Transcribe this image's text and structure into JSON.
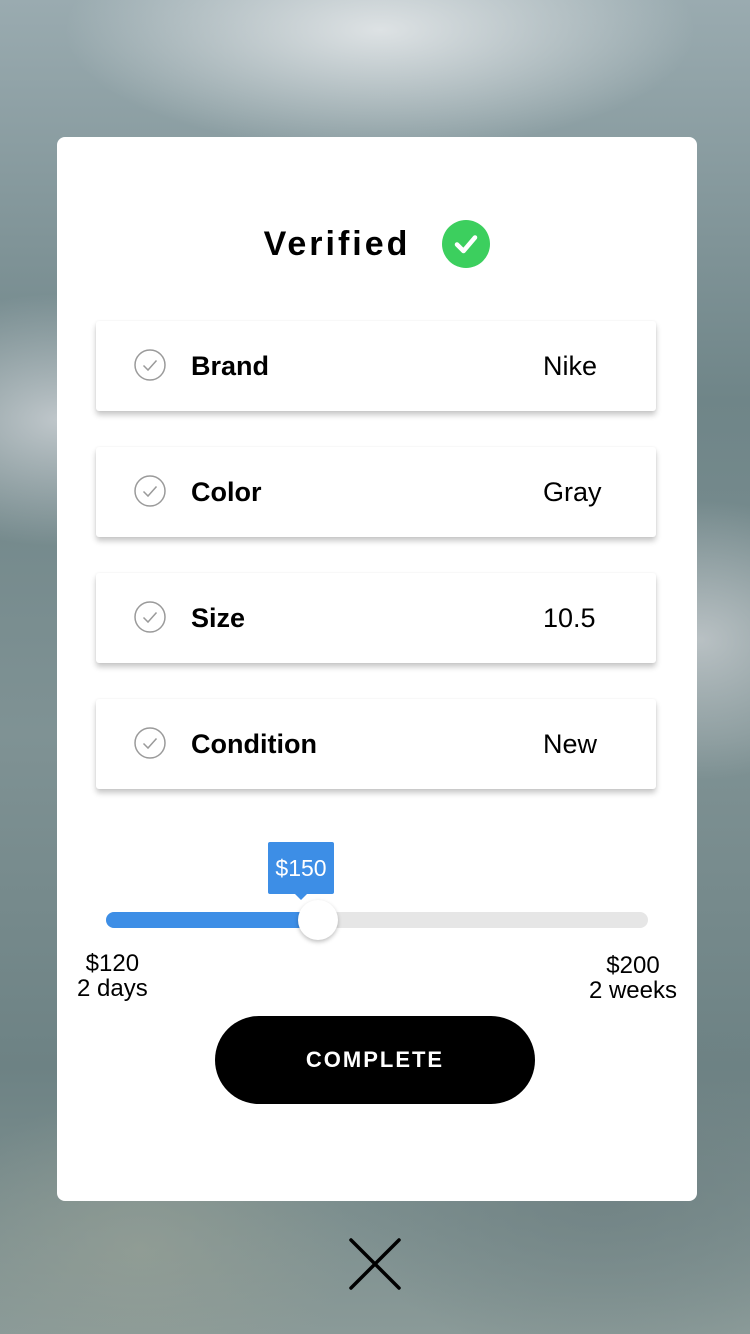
{
  "card": {
    "title": "Verified",
    "badge_icon": "check-circle-icon",
    "badge_color": "#3ccf5e"
  },
  "attributes": [
    {
      "label": "Brand",
      "value": "Nike"
    },
    {
      "label": "Color",
      "value": "Gray"
    },
    {
      "label": "Size",
      "value": "10.5"
    },
    {
      "label": "Condition",
      "value": "New"
    }
  ],
  "price_slider": {
    "current_label": "$150",
    "current_value": 150,
    "min_price": "$120",
    "min_time": "2 days",
    "max_price": "$200",
    "max_time": "2 weeks",
    "accent_color": "#3d8ee6"
  },
  "complete_button": {
    "label": "COMPLETE"
  },
  "close_button": {
    "icon": "close-icon"
  }
}
